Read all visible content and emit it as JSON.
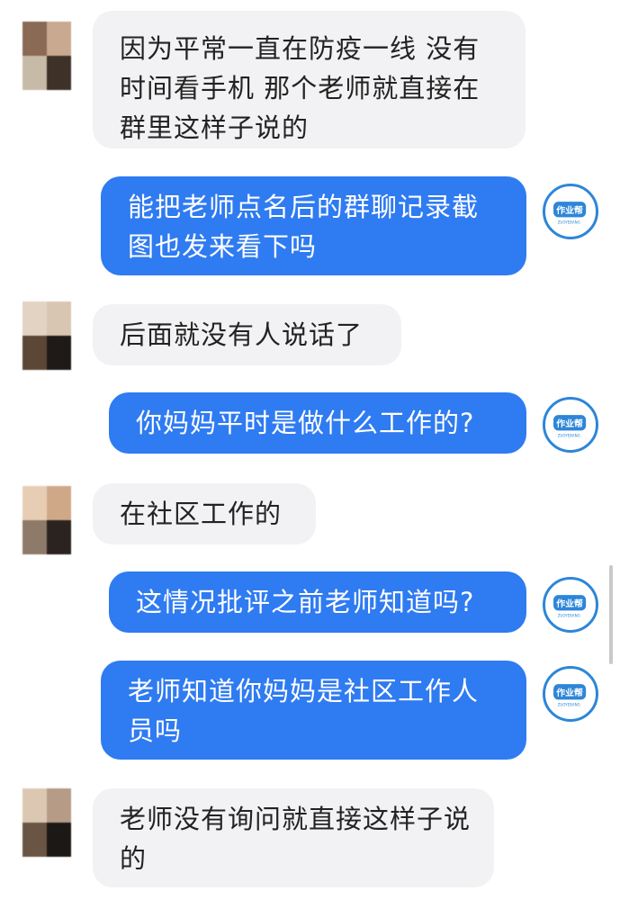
{
  "conversation": {
    "messages": [
      {
        "side": "in",
        "text": "因为平常一直在防疫一线 没有时间看手机 那个老师就直接在群里这样子说的"
      },
      {
        "side": "out",
        "text": "能把老师点名后的群聊记录截图也发来看下吗"
      },
      {
        "side": "in",
        "text": "后面就没有人说话了"
      },
      {
        "side": "out",
        "text": "你妈妈平时是做什么工作的?"
      },
      {
        "side": "in",
        "text": "在社区工作的"
      },
      {
        "side": "out",
        "text": "这情况批评之前老师知道吗?"
      },
      {
        "side": "out",
        "text": "老师知道你妈妈是社区工作人员吗"
      },
      {
        "side": "in",
        "text": "老师没有询问就直接这样子说的"
      }
    ]
  },
  "bot_avatar": {
    "logo_text": "作业帮",
    "sub_text": "ZUOYEBANG",
    "ring_color": "#2d86d8"
  },
  "colors": {
    "outgoing_bubble": "#2f7bf1",
    "incoming_bubble": "#f2f2f4"
  }
}
